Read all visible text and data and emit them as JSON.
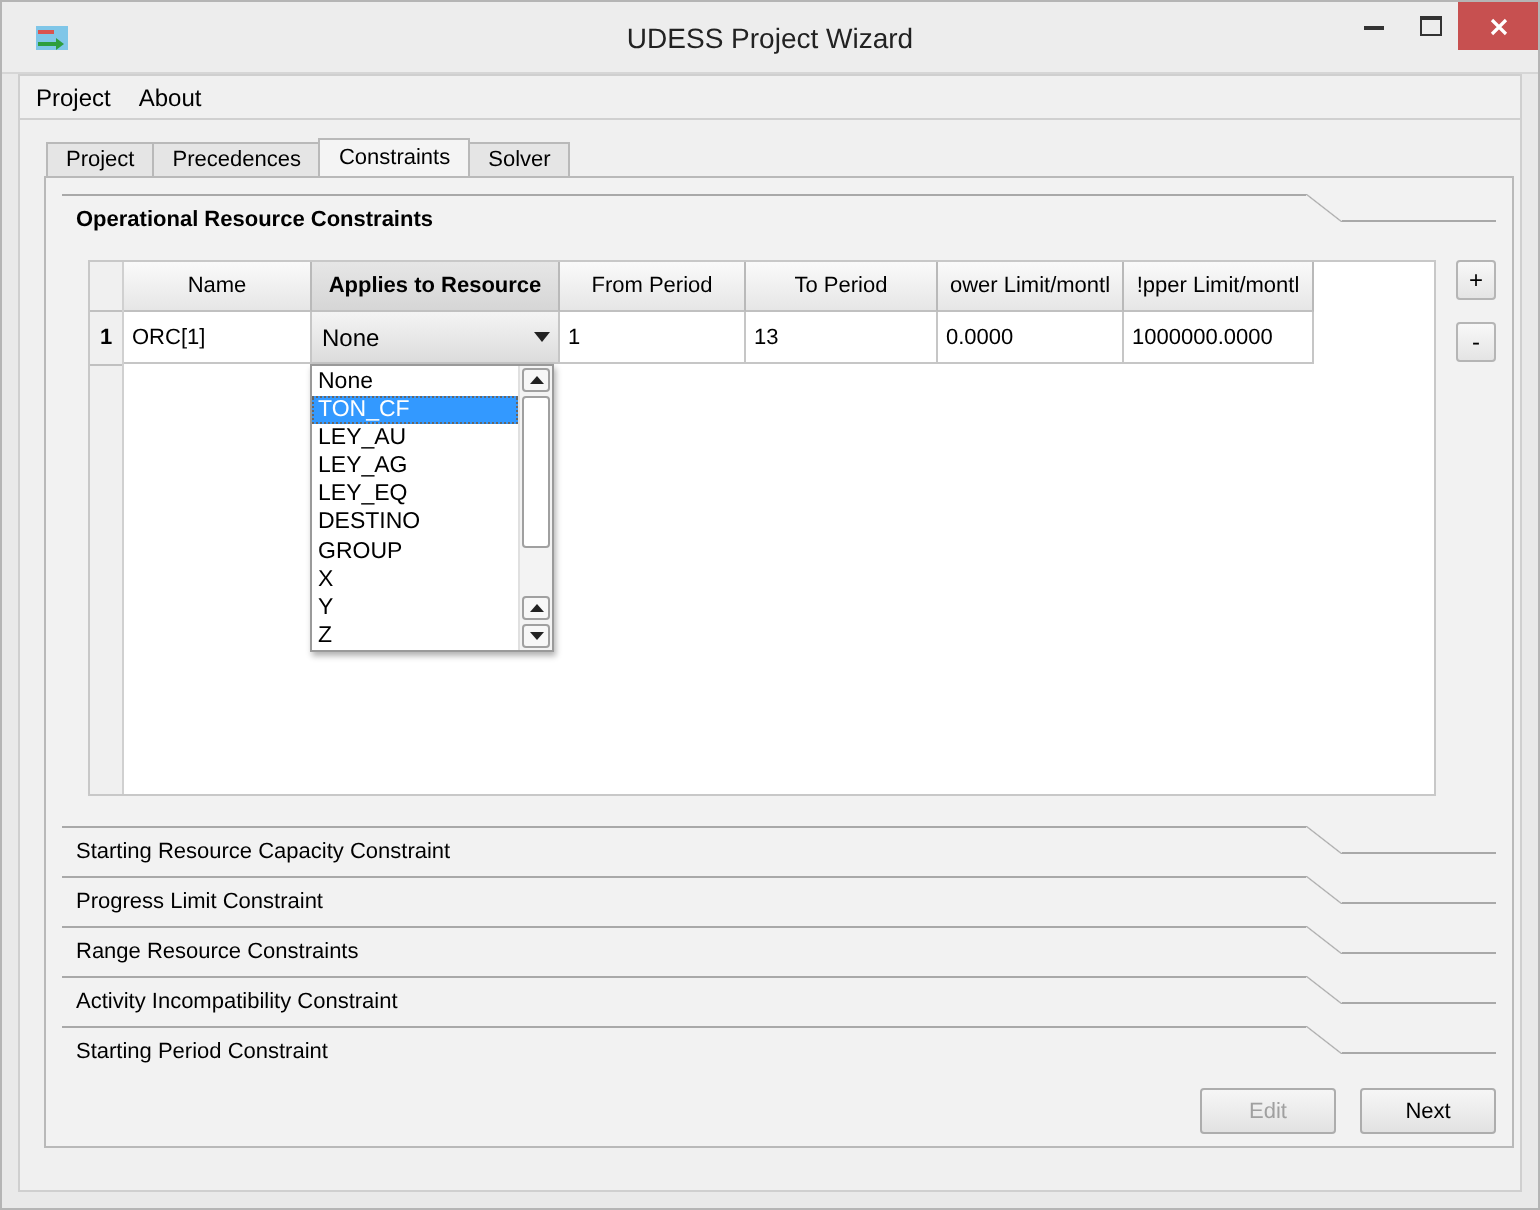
{
  "window": {
    "title": "UDESS Project Wizard"
  },
  "menu": [
    "Project",
    "About"
  ],
  "tabs": [
    {
      "label": "Project",
      "selected": false
    },
    {
      "label": "Precedences",
      "selected": false
    },
    {
      "label": "Constraints",
      "selected": true
    },
    {
      "label": "Solver",
      "selected": false
    }
  ],
  "sections": [
    {
      "title": "Operational Resource Constraints",
      "expanded": true
    },
    {
      "title": "Starting Resource Capacity Constraint",
      "expanded": false
    },
    {
      "title": "Progress Limit Constraint",
      "expanded": false
    },
    {
      "title": "Range Resource Constraints",
      "expanded": false
    },
    {
      "title": "Activity Incompatibility Constraint",
      "expanded": false
    },
    {
      "title": "Starting Period Constraint",
      "expanded": false
    }
  ],
  "table": {
    "columns": [
      {
        "label": "Name",
        "selected": false
      },
      {
        "label": "Applies to Resource",
        "selected": true
      },
      {
        "label": "From Period",
        "selected": false
      },
      {
        "label": "To Period",
        "selected": false
      },
      {
        "label": "ower Limit/montl",
        "selected": false
      },
      {
        "label": "!pper Limit/montl",
        "selected": false
      }
    ],
    "rows": [
      {
        "header": "1",
        "cells": [
          {
            "kind": "text",
            "text": "ORC[1]"
          },
          {
            "kind": "combo",
            "text": "None"
          },
          {
            "kind": "text",
            "text": "1"
          },
          {
            "kind": "text",
            "text": "13"
          },
          {
            "kind": "text",
            "text": "0.0000"
          },
          {
            "kind": "text",
            "text": "1000000.0000"
          }
        ]
      }
    ]
  },
  "dropdown": {
    "options": [
      {
        "label": "None",
        "selected": false
      },
      {
        "label": "TON_CF",
        "selected": true
      },
      {
        "label": "LEY_AU",
        "selected": false
      },
      {
        "label": "LEY_AG",
        "selected": false
      },
      {
        "label": "LEY_EQ",
        "selected": false
      },
      {
        "label": "DESTINO",
        "selected": false
      },
      {
        "label": "GROUP",
        "selected": false
      },
      {
        "label": "X",
        "selected": false
      },
      {
        "label": "Y",
        "selected": false
      },
      {
        "label": "Z",
        "selected": false
      }
    ]
  },
  "side_buttons": [
    "+",
    "-"
  ],
  "buttons": [
    {
      "label": "Edit",
      "disabled": true
    },
    {
      "label": "Next",
      "disabled": false
    }
  ]
}
